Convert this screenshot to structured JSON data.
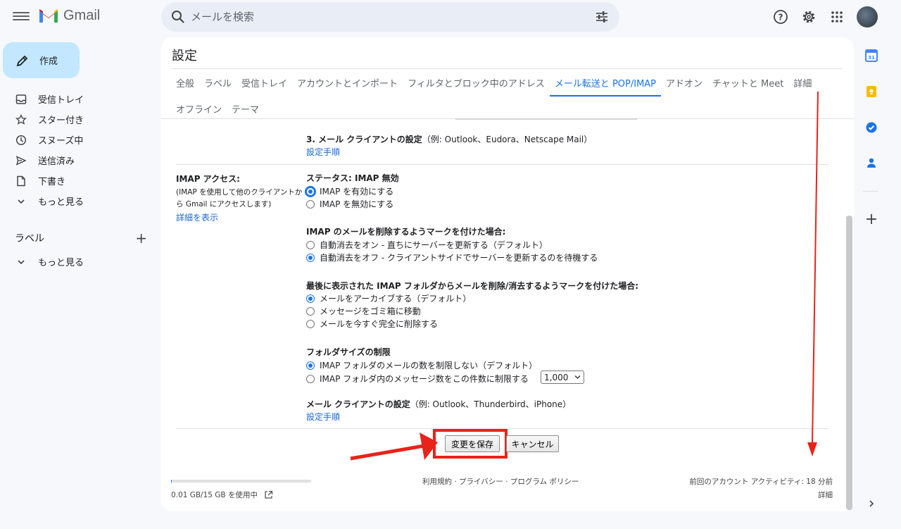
{
  "app": {
    "name": "Gmail"
  },
  "search": {
    "placeholder": "メールを検索"
  },
  "compose": {
    "label": "作成"
  },
  "nav": {
    "items": [
      {
        "label": "受信トレイ",
        "icon": "inbox-icon"
      },
      {
        "label": "スター付き",
        "icon": "star-icon"
      },
      {
        "label": "スヌーズ中",
        "icon": "clock-icon"
      },
      {
        "label": "送信済み",
        "icon": "send-icon"
      },
      {
        "label": "下書き",
        "icon": "draft-icon"
      },
      {
        "label": "もっと見る",
        "icon": "chevron-down-icon"
      }
    ],
    "labels_title": "ラベル",
    "labels_more": "もっと見る"
  },
  "settings": {
    "title": "設定",
    "tabs_row1": [
      "全般",
      "ラベル",
      "受信トレイ",
      "アカウントとインポート",
      "フィルタとブロック中のアドレス",
      "メール転送と POP/IMAP",
      "アドオン",
      "チャットと Meet",
      "詳細"
    ],
    "tabs_row2": [
      "オフライン",
      "テーマ"
    ],
    "active_tab": "メール転送と POP/IMAP"
  },
  "pop": {
    "step3_title": "3. メール クライアントの設定",
    "step3_example": "（例: Outlook、Eudora、Netscape Mail）",
    "step3_link": "設定手順"
  },
  "imap": {
    "label": "IMAP アクセス:",
    "desc_line1": "(IMAP を使用して他のクライアントか",
    "desc_line2": "ら Gmail にアクセスします)",
    "more_link": "詳細を表示",
    "status": "ステータス: IMAP 無効",
    "enable": "IMAP を有効にする",
    "disable": "IMAP を無効にする",
    "expunge_title": "IMAP のメールを削除するようマークを付けた場合:",
    "expunge_on": "自動消去をオン - 直ちにサーバーを更新する（デフォルト）",
    "expunge_off": "自動消去をオフ - クライアントサイドでサーバーを更新するのを待機する",
    "delete_title": "最後に表示された IMAP フォルダからメールを削除/消去するようマークを付けた場合:",
    "delete_archive": "メールをアーカイブする（デフォルト）",
    "delete_trash": "メッセージをゴミ箱に移動",
    "delete_now": "メールを今すぐ完全に削除する",
    "folder_title": "フォルダサイズの制限",
    "folder_nolimit": "IMAP フォルダのメールの数を制限しない（デフォルト）",
    "folder_limit": "IMAP フォルダ内のメッセージ数をこの件数に制限する",
    "folder_limit_value": "1,000",
    "client_title": "メール クライアントの設定",
    "client_example": "（例: Outlook、Thunderbird、iPhone）",
    "client_link": "設定手順"
  },
  "buttons": {
    "save": "変更を保存",
    "cancel": "キャンセル"
  },
  "footer": {
    "storage": "0.01 GB/15 GB を使用中",
    "storage_fraction": 0.0007,
    "links": "利用規約 · プライバシー · プログラム ポリシー",
    "activity": "前回のアカウント アクティビティ: 18 分前",
    "details": "詳細"
  },
  "colors": {
    "accent": "#1a73e8",
    "annotation": "#e8231a",
    "compose_bg": "#c2e7ff"
  }
}
